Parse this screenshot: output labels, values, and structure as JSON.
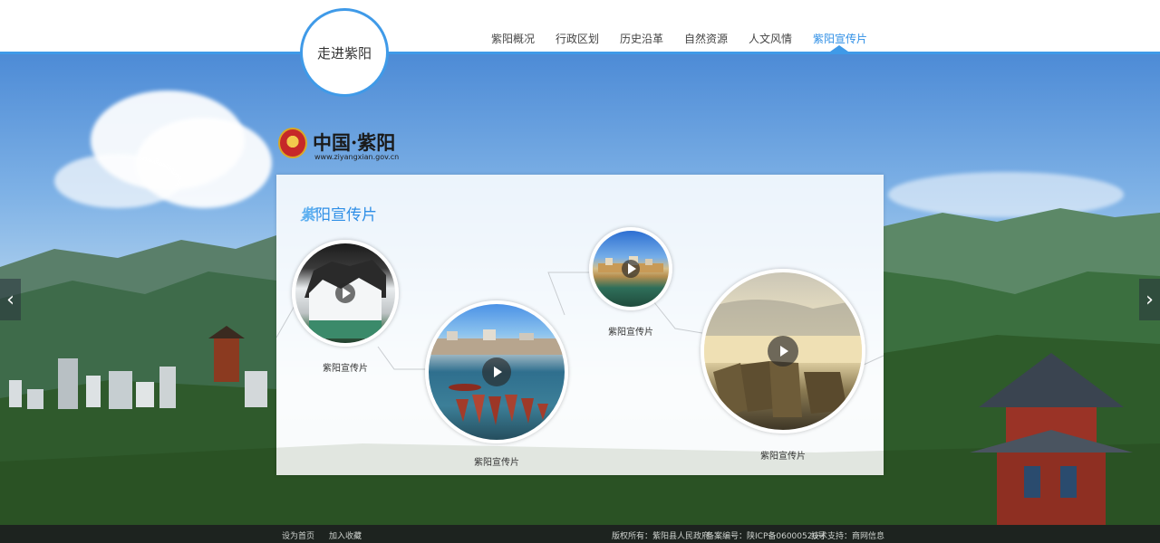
{
  "header": {
    "logo_label": "走进紫阳",
    "nav": [
      {
        "label": "紫阳概况",
        "active": false
      },
      {
        "label": "行政区划",
        "active": false
      },
      {
        "label": "历史沿革",
        "active": false
      },
      {
        "label": "自然资源",
        "active": false
      },
      {
        "label": "人文风情",
        "active": false
      },
      {
        "label": "紫阳宣传片",
        "active": true
      }
    ]
  },
  "site_logo": {
    "text": "中国·紫阳",
    "url": "www.ziyangxian.gov.cn"
  },
  "side_arrows": {
    "left": "‹",
    "right": "›"
  },
  "panel": {
    "title_first": "紫",
    "title_rest": "阳宣传片",
    "videos": [
      {
        "label": "紫阳宣传片",
        "scene": "waterfall-icon"
      },
      {
        "label": "紫阳宣传片",
        "scene": "boats-lake-icon"
      },
      {
        "label": "紫阳宣传片",
        "scene": "river-town-icon"
      },
      {
        "label": "紫阳宣传片",
        "scene": "wooden-boats-icon"
      }
    ]
  },
  "footer": {
    "set_home": "设为首页",
    "add_favorite": "加入收藏",
    "copyright": "版权所有：紫阳县人民政府",
    "icp": "备案编号：陕ICP备06000520号",
    "tech": "技术支持：商网信息"
  },
  "colors": {
    "accent": "#3f9ae8",
    "footer_bg": "#1d231f"
  }
}
